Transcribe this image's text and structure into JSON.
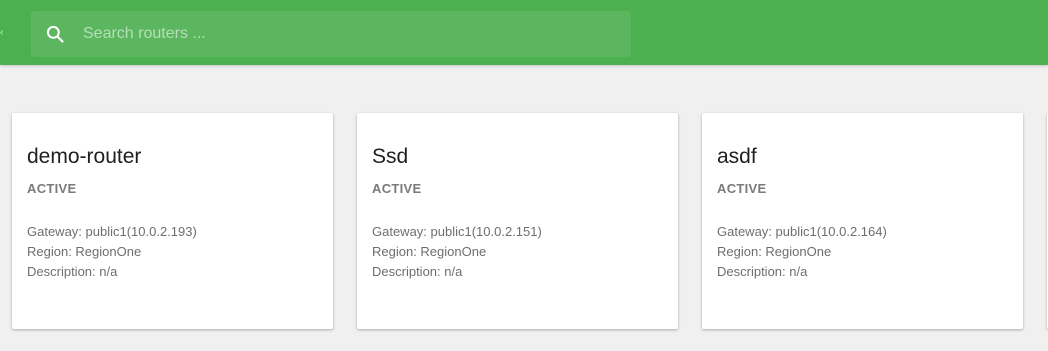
{
  "search": {
    "placeholder": "Search routers ..."
  },
  "colors": {
    "topbar": "#4caf50",
    "background": "#f0f0f0"
  },
  "routers": [
    {
      "name": "demo-router",
      "status": "ACTIVE",
      "gateway_label": "Gateway: ",
      "gateway": "public1(10.0.2.193)",
      "region_label": "Region: ",
      "region": "RegionOne",
      "description_label": "Description: ",
      "description": "n/a"
    },
    {
      "name": "Ssd",
      "status": "ACTIVE",
      "gateway_label": "Gateway: ",
      "gateway": "public1(10.0.2.151)",
      "region_label": "Region: ",
      "region": "RegionOne",
      "description_label": "Description: ",
      "description": "n/a"
    },
    {
      "name": "asdf",
      "status": "ACTIVE",
      "gateway_label": "Gateway: ",
      "gateway": "public1(10.0.2.164)",
      "region_label": "Region: ",
      "region": "RegionOne",
      "description_label": "Description: ",
      "description": "n/a"
    }
  ]
}
